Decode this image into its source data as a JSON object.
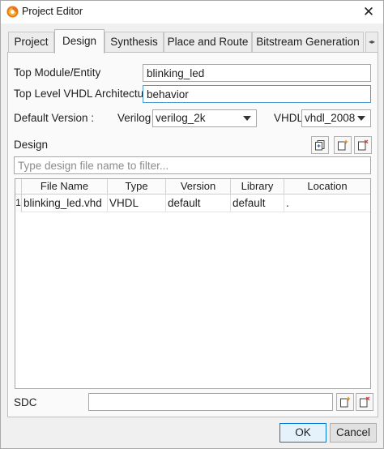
{
  "window": {
    "title": "Project Editor",
    "close_glyph": "✕"
  },
  "tabs": [
    {
      "label": "Project",
      "active": false
    },
    {
      "label": "Design",
      "active": true
    },
    {
      "label": "Synthesis",
      "active": false
    },
    {
      "label": "Place and Route",
      "active": false
    },
    {
      "label": "Bitstream Generation",
      "active": false
    }
  ],
  "tab_scroll_glyph": "◂▸",
  "design": {
    "top_module_label": "Top Module/Entity",
    "top_module_value": "blinking_led",
    "top_vhdl_arch_label": "Top Level VHDL Architecture",
    "top_vhdl_arch_value": "behavior",
    "default_version_label": "Default Version :",
    "verilog_label": "Verilog",
    "verilog_value": "verilog_2k",
    "vhdl_label": "VHDL",
    "vhdl_value": "vhdl_2008",
    "design_section_label": "Design",
    "filter_placeholder": "Type design file name to filter...",
    "table": {
      "columns": [
        "File Name",
        "Type",
        "Version",
        "Library",
        "Location"
      ],
      "rows": [
        {
          "num": "1",
          "file_name": "blinking_led.vhd",
          "type": "VHDL",
          "version": "default",
          "library": "default",
          "location": "."
        }
      ]
    },
    "sdc_label": "SDC",
    "sdc_value": ""
  },
  "buttons": {
    "ok": "OK",
    "cancel": "Cancel"
  },
  "icons": {
    "app": "gowin-logo-icon",
    "add_files": "add-files-icon",
    "new_file": "new-file-icon",
    "remove_file": "remove-file-icon"
  },
  "colors": {
    "focus_border": "#4a9ad4",
    "default_button_border": "#0078d7",
    "remove_accent": "#d23a3a",
    "add_accent": "#e08a1e"
  }
}
